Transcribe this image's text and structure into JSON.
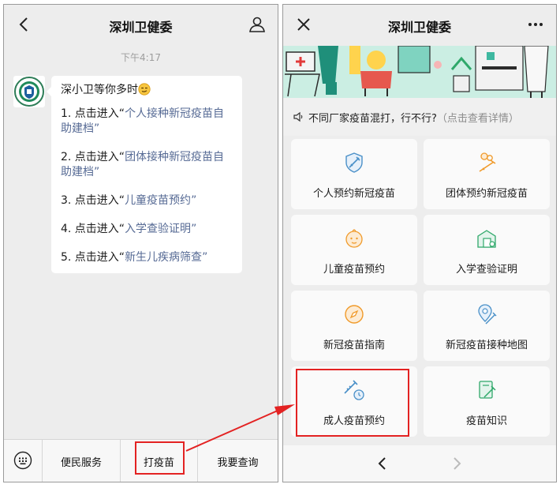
{
  "left_panel": {
    "title": "深圳卫健委",
    "timestamp": "下午4:17",
    "message": {
      "greeting": "深小卫等你多时",
      "items": [
        {
          "prefix": "1. 点击进入“",
          "link": "个人接种新冠疫苗自助建档",
          "suffix": "”"
        },
        {
          "prefix": "2. 点击进入“",
          "link": "团体接种新冠疫苗自助建档",
          "suffix": "”"
        },
        {
          "prefix": "3. 点击进入“",
          "link": "儿童疫苗预约",
          "suffix": "”"
        },
        {
          "prefix": "4. 点击进入“",
          "link": "入学查验证明",
          "suffix": "”"
        },
        {
          "prefix": "5. 点击进入“",
          "link": "新生儿疾病筛查",
          "suffix": "”"
        }
      ]
    },
    "bottom_menu": [
      "便民服务",
      "打疫苗",
      "我要查询"
    ]
  },
  "right_panel": {
    "title": "深圳卫健委",
    "notice": "不同厂家疫苗混打，行不行?",
    "notice_hint": "（点击查看详情）",
    "cards": [
      {
        "label": "个人预约新冠疫苗",
        "icon": "shield-syringe-icon"
      },
      {
        "label": "团体预约新冠疫苗",
        "icon": "group-syringe-icon"
      },
      {
        "label": "儿童疫苗预约",
        "icon": "baby-face-icon"
      },
      {
        "label": "入学查验证明",
        "icon": "school-certificate-icon"
      },
      {
        "label": "新冠疫苗指南",
        "icon": "compass-icon"
      },
      {
        "label": "新冠疫苗接种地图",
        "icon": "map-pin-syringe-icon"
      },
      {
        "label": "成人疫苗预约",
        "icon": "syringe-clock-icon"
      },
      {
        "label": "疫苗知识",
        "icon": "book-syringe-icon"
      }
    ]
  },
  "colors": {
    "link": "#576b95",
    "highlight": "#e32222",
    "icon_blue": "#4a90c8",
    "icon_orange": "#f09a2a",
    "icon_green": "#2fa86a",
    "hero_bg": "#cbeee3"
  }
}
